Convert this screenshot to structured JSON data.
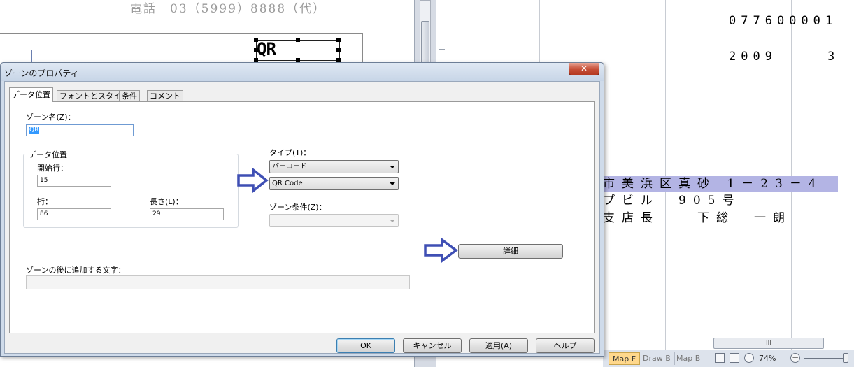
{
  "background": {
    "phone_text": "電話　03（5999）8888（代）",
    "qr_zone_text": "QR",
    "code_number": "077600001",
    "year_text": "2009　　　3",
    "address_text": "市美浜区真砂 1－23－4",
    "line2_text": "プビル　905号",
    "line3_text": "支店長　　下総　一朗"
  },
  "status_bar": {
    "sheet_tabs": [
      "Map F",
      "Draw B",
      "Map B"
    ],
    "active_tab": "Map F",
    "zoom": "74%",
    "hscroll_grip": "III"
  },
  "dialog": {
    "title": "ゾーンのプロパティ",
    "close_label": "✕",
    "tabs": [
      {
        "label": "データ位置",
        "active": true
      },
      {
        "label": "フォントとスタイル",
        "active": false
      },
      {
        "label": "条件",
        "active": false
      },
      {
        "label": "コメント",
        "active": false
      }
    ],
    "zone_name": {
      "label": "ゾーン名(Z)：",
      "value": "QR"
    },
    "data_position": {
      "group_label": "データ位置",
      "start_row": {
        "label": "開始行：",
        "value": "15"
      },
      "column": {
        "label": "桁：",
        "value": "86"
      },
      "length": {
        "label": "長さ(L)：",
        "value": "29"
      }
    },
    "type": {
      "label": "タイプ(T)：",
      "value": "バーコード"
    },
    "subtype": {
      "value": "QR Code"
    },
    "zone_condition": {
      "label": "ゾーン条件(Z)：",
      "value": ""
    },
    "details_button": "詳細",
    "append_text": {
      "label": "ゾーンの後に追加する文字：",
      "value": ""
    },
    "buttons": {
      "ok": "OK",
      "cancel": "キャンセル",
      "apply": "適用(A)",
      "help": "ヘルプ"
    }
  },
  "annotation_color": "#3f4fb4"
}
